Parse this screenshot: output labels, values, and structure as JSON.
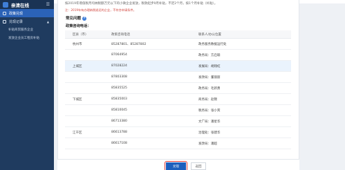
{
  "sidebar": {
    "brand": "亲清在线",
    "items": [
      {
        "label": "政策兑现",
        "active": true
      },
      {
        "label": "兑现记录",
        "active": false
      }
    ],
    "sub_items": [
      "补贴商贸服务企业",
      "发放企业员工租房补贴"
    ]
  },
  "content": {
    "intro": "按2019年增值税月均纳税额万元以下的小微企业发放，税款起步9月补贴，不足2个月，按1个月补贴（补贴）。",
    "note": "注：2019年有办理纳税退还的企业，不符合申请条件。",
    "faq_title": "常见问题",
    "phone_title": "政策咨询电话："
  },
  "table": {
    "headers": [
      "区县（市）",
      "政策咨询电话",
      "联系人/办公位置"
    ],
    "rows": [
      {
        "district": "杭州市",
        "phone": "85287801、85287802",
        "contact": "政务服务数据运行处"
      },
      {
        "district": "",
        "phone": "87064954",
        "contact": "政务局：方启瑜"
      },
      {
        "district": "上城区",
        "phone": "87028224",
        "contact": "发展局：胡翔虹"
      },
      {
        "district": "",
        "phone": "87803308",
        "contact": "发改局：董丽丽"
      },
      {
        "district": "",
        "phone": "85835525",
        "contact": "政务局：毛新勇"
      },
      {
        "district": "下城区",
        "phone": "85835003",
        "contact": "商务局：赵锦"
      },
      {
        "district": "",
        "phone": "85810045",
        "contact": "税务局：张小宾"
      },
      {
        "district": "",
        "phone": "86713380",
        "contact": "文广局：潘星华"
      },
      {
        "district": "江干区",
        "phone": "86613788",
        "contact": "治理处：张建华"
      },
      {
        "district": "",
        "phone": "86617108",
        "contact": "发改局：潘超"
      }
    ]
  },
  "buttons": {
    "confirm": "兑现",
    "back": "返回"
  },
  "colors": {
    "sidebar": "#1f3b5f",
    "active": "#2b63b8",
    "primary": "#1d5fbd",
    "alert": "#d2463e"
  }
}
